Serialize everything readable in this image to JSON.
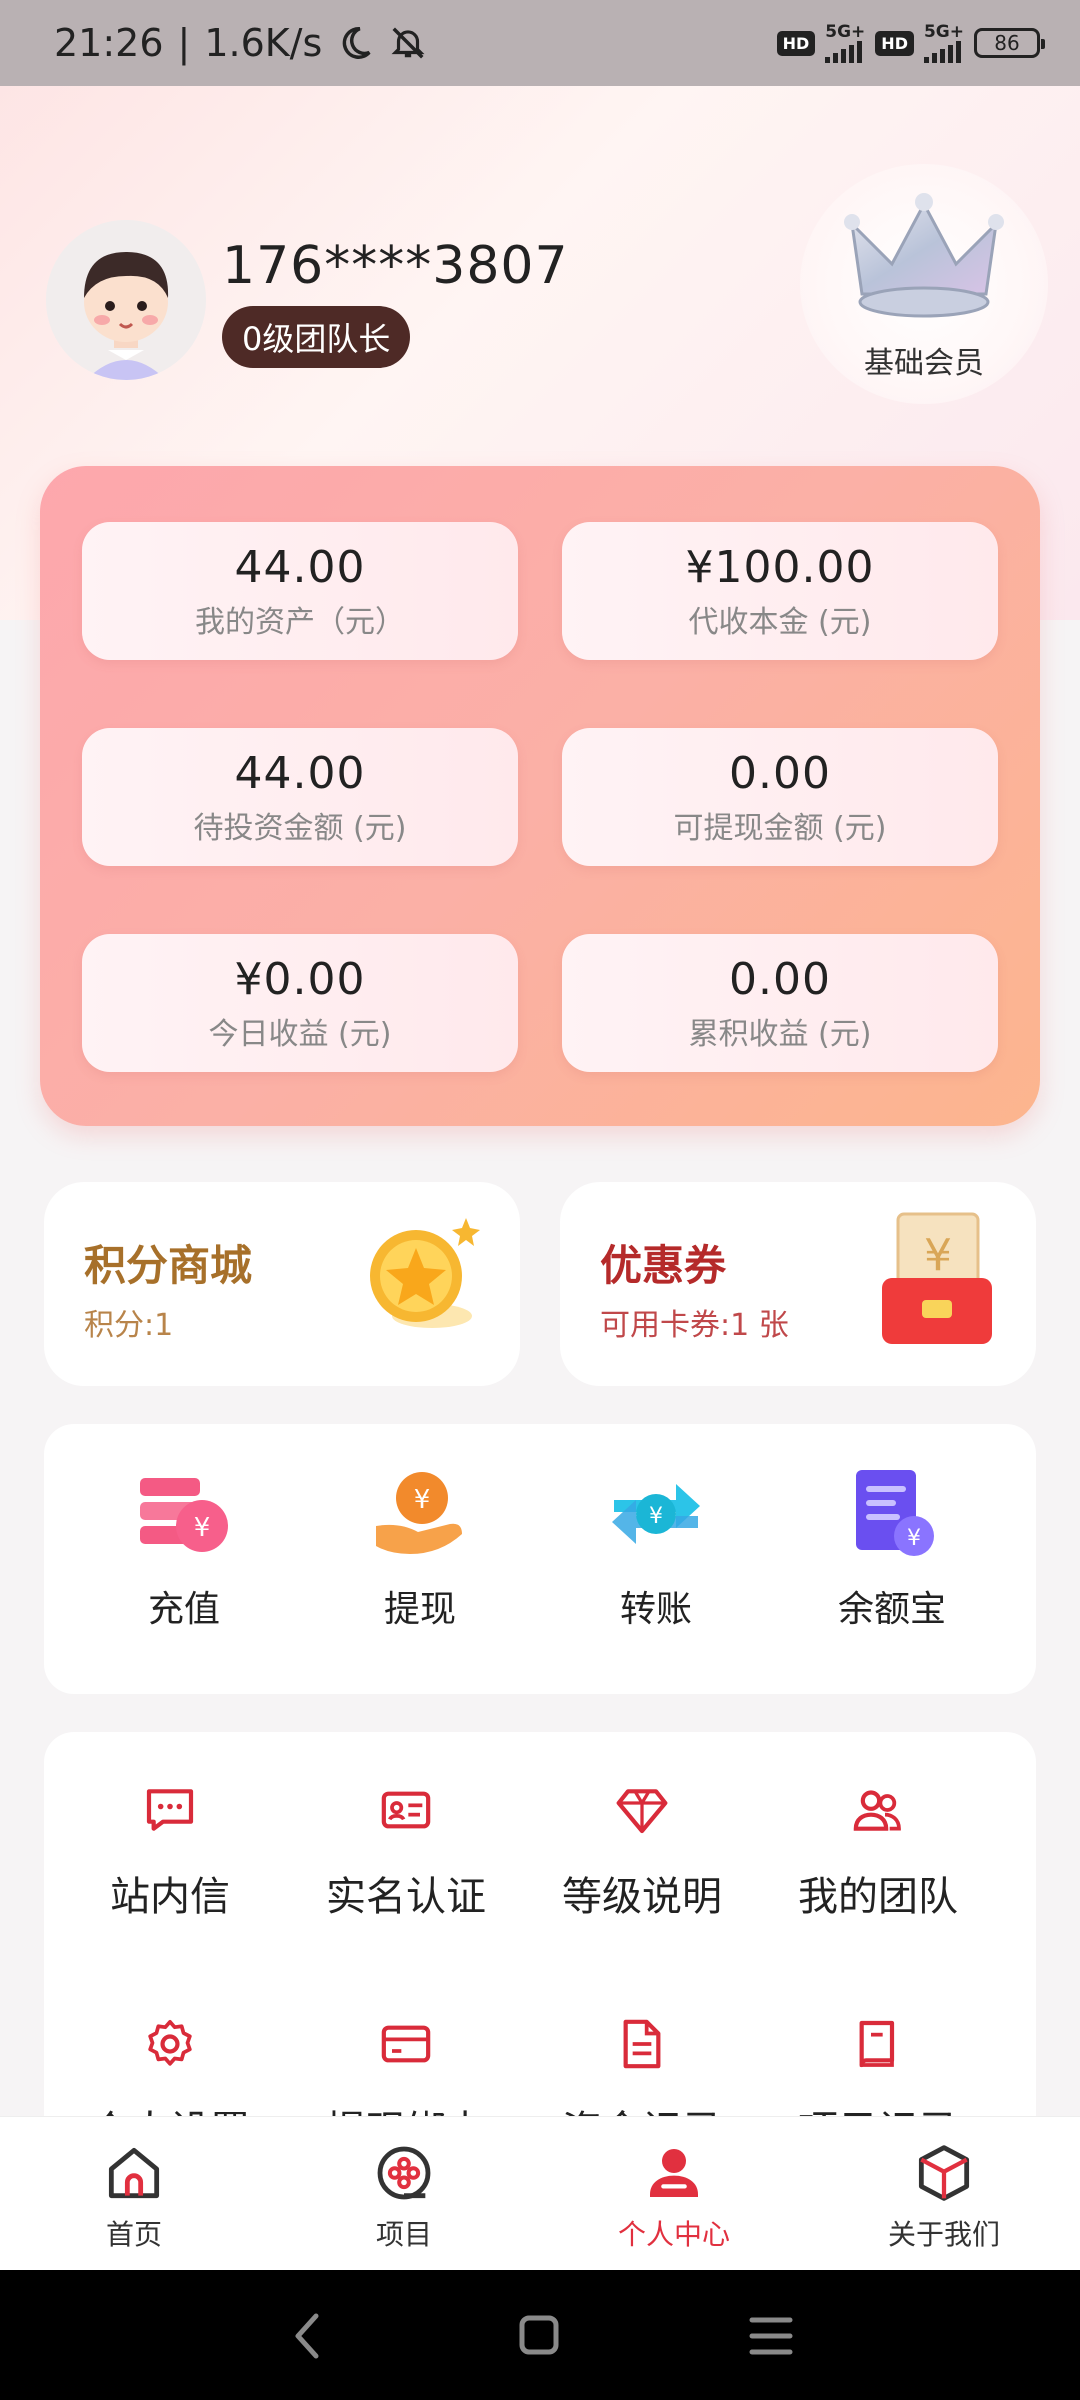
{
  "status_bar": {
    "time": "21:26",
    "speed": "1.6K/s",
    "hd1": "HD",
    "net1": "5G+",
    "hd2": "HD",
    "net2": "5G+",
    "battery": "86"
  },
  "profile": {
    "phone": "176****3807",
    "level": "0级团队长",
    "membership": "基础会员"
  },
  "assets": [
    {
      "value": "44.00",
      "label": "我的资产（元）"
    },
    {
      "value": "¥100.00",
      "label": "代收本金 (元)"
    },
    {
      "value": "44.00",
      "label": "待投资金额 (元)"
    },
    {
      "value": "0.00",
      "label": "可提现金额 (元)"
    },
    {
      "value": "¥0.00",
      "label": "今日收益 (元)"
    },
    {
      "value": "0.00",
      "label": "累积收益 (元)"
    }
  ],
  "points": {
    "title": "积分商城",
    "subtitle": "积分:1",
    "color": "#a7702a"
  },
  "coupon": {
    "title": "优惠券",
    "subtitle": "可用卡券:1 张",
    "color": "#b52a2a"
  },
  "quick_actions": [
    {
      "label": "充值",
      "icon": "recharge-icon"
    },
    {
      "label": "提现",
      "icon": "withdraw-icon"
    },
    {
      "label": "转账",
      "icon": "transfer-icon"
    },
    {
      "label": "余额宝",
      "icon": "balance-treasure-icon"
    }
  ],
  "menu": [
    {
      "label": "站内信",
      "icon": "message-icon"
    },
    {
      "label": "实名认证",
      "icon": "id-card-icon"
    },
    {
      "label": "等级说明",
      "icon": "diamond-icon"
    },
    {
      "label": "我的团队",
      "icon": "team-icon"
    },
    {
      "label": "个人设置",
      "icon": "gear-icon"
    },
    {
      "label": "提现绑卡",
      "icon": "bank-card-icon"
    },
    {
      "label": "资金记录",
      "icon": "document-icon"
    },
    {
      "label": "项目记录",
      "icon": "book-icon"
    }
  ],
  "bottom_nav": [
    {
      "label": "首页",
      "icon": "home-icon"
    },
    {
      "label": "项目",
      "icon": "project-icon"
    },
    {
      "label": "个人中心",
      "icon": "user-icon"
    },
    {
      "label": "关于我们",
      "icon": "cube-icon"
    }
  ],
  "colors": {
    "accent": "#e1303f",
    "level_badge": "#4e2a26"
  }
}
